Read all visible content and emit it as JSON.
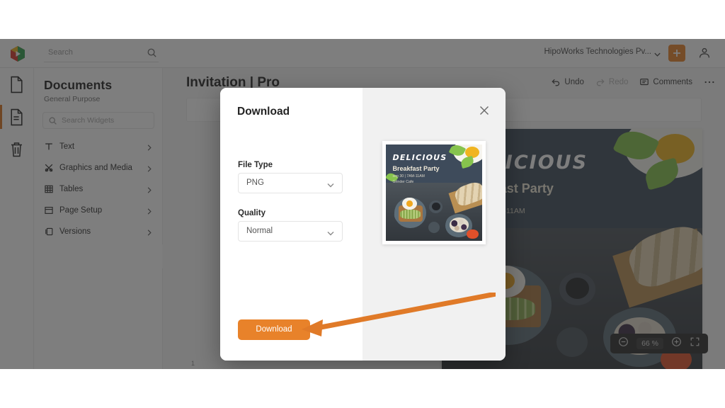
{
  "app": {
    "logo_icon": "hexagon-play-logo"
  },
  "topbar": {
    "search_placeholder": "Search",
    "search_icon": "search-icon",
    "org_name": "HipoWorks Technologies Pv...",
    "org_caret_icon": "chevron-down-icon",
    "add_icon": "plus-icon",
    "account_icon": "user-icon"
  },
  "rail": {
    "items": [
      {
        "name": "document",
        "icon": "file-icon",
        "active": false
      },
      {
        "name": "pages",
        "icon": "file-lines-icon",
        "active": true
      },
      {
        "name": "trash",
        "icon": "trash-icon",
        "active": false
      }
    ]
  },
  "panel": {
    "title": "Documents",
    "subtitle": "General Purpose",
    "search_placeholder": "Search Widgets",
    "search_icon": "search-icon",
    "items": [
      {
        "label": "Text",
        "icon": "text-icon",
        "chevron": "chevron-right-icon"
      },
      {
        "label": "Graphics and Media",
        "icon": "graphics-icon",
        "chevron": "chevron-right-icon"
      },
      {
        "label": "Tables",
        "icon": "table-icon",
        "chevron": "chevron-right-icon"
      },
      {
        "label": "Page Setup",
        "icon": "page-setup-icon",
        "chevron": "chevron-right-icon"
      },
      {
        "label": "Versions",
        "icon": "versions-icon",
        "chevron": "chevron-right-icon"
      }
    ],
    "collapse_handle_icon": "panel-collapse-handle"
  },
  "document": {
    "title": "Invitation | Pro",
    "actions": [
      {
        "label": "Undo",
        "icon": "undo-icon",
        "disabled": false
      },
      {
        "label": "Redo",
        "icon": "redo-icon",
        "disabled": true
      },
      {
        "label": "Comments",
        "icon": "comment-icon",
        "disabled": false
      }
    ],
    "more_icon": "more-horizontal-icon",
    "ruler_mark": "1"
  },
  "poster": {
    "title": "DELICIOUS",
    "subtitle": "Breakfast Party",
    "line1": "sep 30 | 7AM-11AM",
    "line2": "Grinder Cafe"
  },
  "zoom_control": {
    "minus_icon": "zoom-out-icon",
    "value": "66 %",
    "plus_icon": "zoom-in-icon",
    "fullscreen_icon": "fullscreen-icon"
  },
  "modal": {
    "title": "Download",
    "close_icon": "close-icon",
    "file_type": {
      "label": "File Type",
      "value": "PNG",
      "caret_icon": "chevron-down-icon"
    },
    "quality": {
      "label": "Quality",
      "value": "Normal",
      "caret_icon": "chevron-down-icon"
    },
    "download_button": "Download",
    "preview_name": "download-preview-thumbnail"
  },
  "annotation": {
    "arrow_color": "#e07a28",
    "name": "callout-arrow-to-download-button"
  },
  "colors": {
    "accent_orange": "#e8822a",
    "overlay": "rgba(40,40,40,0.60)",
    "modal_right_panel": "#f1f1f1"
  }
}
